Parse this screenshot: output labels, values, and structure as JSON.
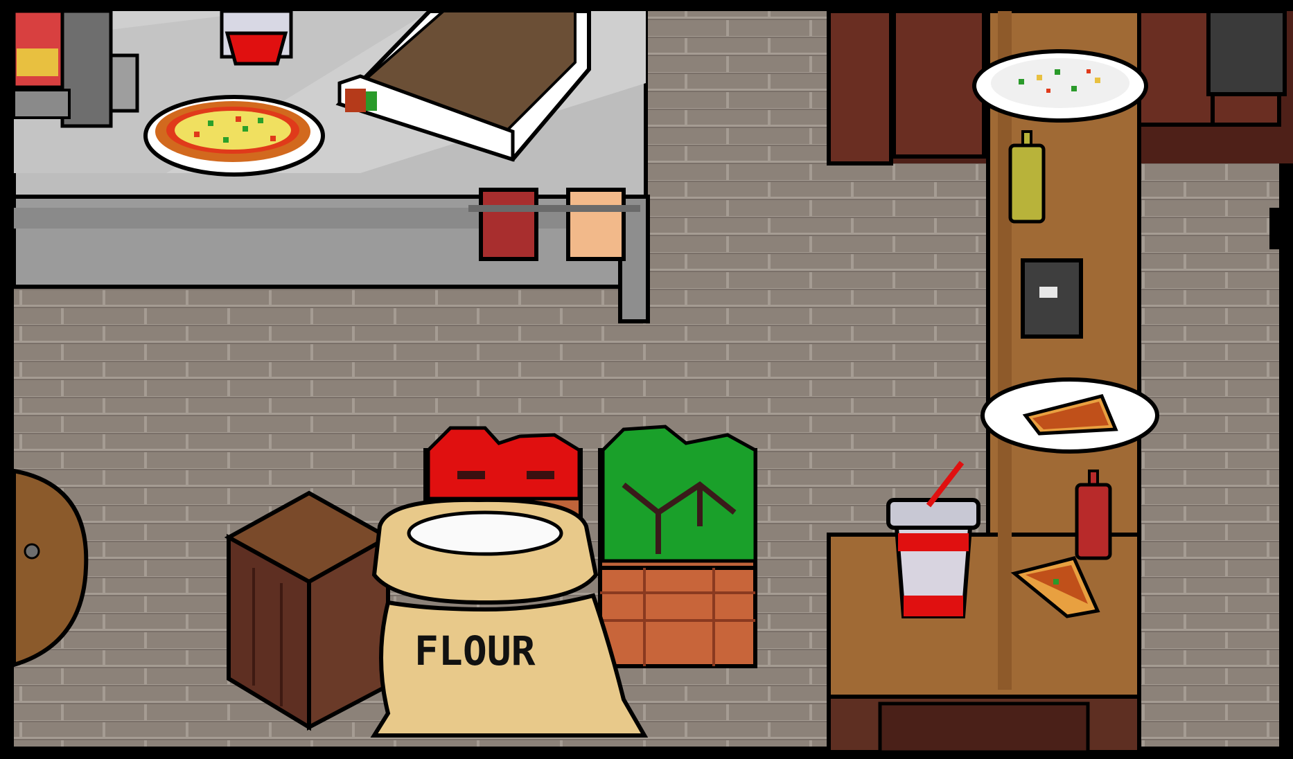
{
  "scene": {
    "name": "pizzeria-kitchen",
    "flour_sack_label": "FLOUR"
  },
  "palette": {
    "frame": "#000000",
    "floor": "#8c8279",
    "floor_line": "#a49b92",
    "counter_top": "#c8c8c8",
    "counter_front": "#9e9e9e",
    "wood_dark": "#5e2f22",
    "wood_mid": "#8b5a2b",
    "bar_wood": "#a06a35",
    "sack": "#e8c98a",
    "tomato": "#e01010",
    "lettuce": "#1aa02a",
    "crate": "#c0643a",
    "cup_red": "#e01010",
    "ketchup": "#b82a2a",
    "mustard": "#b8b33a",
    "towel_red": "#a82e2e",
    "towel_peach": "#f2b98a"
  },
  "objects": [
    {
      "id": "pizza-on-counter",
      "kind": "food"
    },
    {
      "id": "pizza-box",
      "kind": "container"
    },
    {
      "id": "dirty-plate",
      "kind": "dish"
    },
    {
      "id": "plate-with-slice",
      "kind": "dish"
    },
    {
      "id": "mustard-bottle",
      "kind": "condiment"
    },
    {
      "id": "ketchup-bottle",
      "kind": "condiment"
    },
    {
      "id": "soda-cup",
      "kind": "drink"
    },
    {
      "id": "pizza-slice",
      "kind": "food"
    },
    {
      "id": "tomato-crate",
      "kind": "ingredient"
    },
    {
      "id": "lettuce-crate",
      "kind": "ingredient"
    },
    {
      "id": "flour-sack",
      "kind": "ingredient"
    },
    {
      "id": "wooden-crate",
      "kind": "storage"
    },
    {
      "id": "light-switch",
      "kind": "fixture"
    }
  ]
}
